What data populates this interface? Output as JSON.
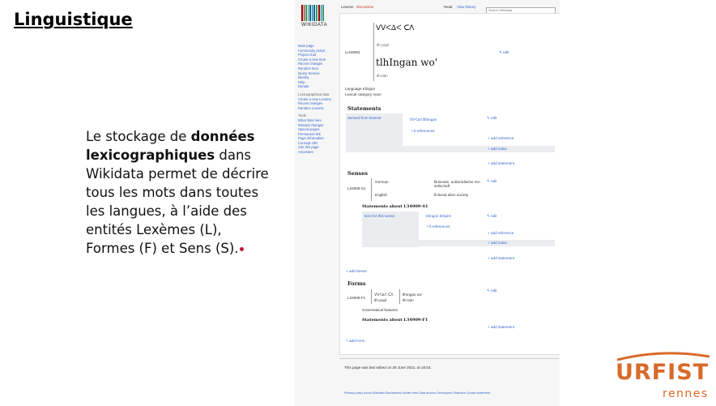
{
  "slide": {
    "title": "Linguistique",
    "text_1": "Le stockage de ",
    "text_bold": "données lexicographiques",
    "text_2": " dans Wikidata permet de décrire tous les mots dans toutes les langues, à l’aide des entités Lexèmes (L), Formes (F) et Sens (S)."
  },
  "screenshot": {
    "logo_text": "WIKIDATA",
    "tabs": [
      "Lexeme",
      "Discussion"
    ],
    "actions": [
      "Read",
      "View history"
    ],
    "search_placeholder": "Search Wikidata",
    "sidebar_nav": [
      "Main page",
      "Community portal",
      "Project chat",
      "Create a new Item",
      "Recent changes",
      "Random Item",
      "Query Service",
      "Nearby",
      "Help",
      "Donate"
    ],
    "sidebar_lex_header": "Lexicographical data",
    "sidebar_lex": [
      "Create a new Lexeme",
      "Recent changes",
      "Random Lexeme"
    ],
    "sidebar_tools_header": "Tools",
    "sidebar_tools": [
      "What links here",
      "Related changes",
      "Special pages",
      "Permanent link",
      "Page information",
      "Concept URI",
      "Cite this page",
      "Ancestors"
    ],
    "lexeme_id": "(L34909)",
    "lemma_piqd": "tlh-piqd",
    "lemma_latn_word": "tlhIngan wo'",
    "lemma_latn": "tlh-latn",
    "edit": "edit",
    "language_line": "Language Klingon",
    "category_line": "Lexical category noun",
    "statements_header": "Statements",
    "derived_prop": "derived from lexeme",
    "derived_val": "tlhIngan",
    "references": "0 references",
    "add_reference": "+ add reference",
    "add_value": "+ add value",
    "add_statement": "+ add statement",
    "senses_header": "Senses",
    "sense_id": "L34909-S1",
    "sense_german": "German",
    "sense_german_gloss": "fiktionale, außerirdische Ge-sellschaft",
    "sense_english": "English",
    "sense_english_gloss": "fictional alien society",
    "sense_statements": "Statements about L34909-S1",
    "item_for_sense": "item for this sense",
    "klingon_empire": "Klingon Empire",
    "add_sense": "+ add Sense",
    "forms_header": "Forms",
    "form_id": "L34909-F1",
    "form_piqd": "tlh-piqd",
    "form_latn_word": "tlhIngan wo'",
    "form_latn": "tlh-latn",
    "grammatical_features": "Grammatical features",
    "form_statements": "Statements about L34909-F1",
    "add_form": "+ add Form",
    "footer_edited": "This page was last edited on 29 June 2021, at 18:54.",
    "footer_links": "Privacy policy   About Wikidata   Disclaimers   Mobile view   Data access   Developers   Statistics   Cookie statement"
  },
  "logo": {
    "word": "URFIST",
    "city": "rennes"
  },
  "colors": {
    "accent": "#d86a2a",
    "link": "#3366cc",
    "bullet": "#c0143c"
  }
}
